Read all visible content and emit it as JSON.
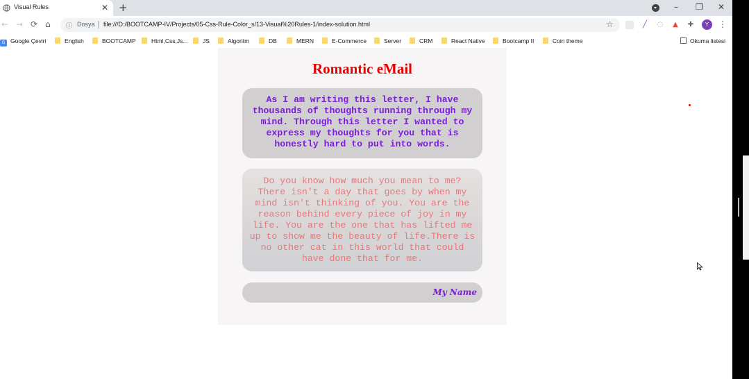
{
  "tab": {
    "title": "Visual Rules",
    "close": "✕"
  },
  "newtab_label": "+",
  "window": {
    "minimize": "–",
    "restore": "❐",
    "close": "✕"
  },
  "nav": {
    "back": "←",
    "forward": "→",
    "reload": "⟳",
    "home": "⌂"
  },
  "address": {
    "info_icon": "ⓘ",
    "scheme_label": "Dosya",
    "separator": "|",
    "url": "file:///D:/BOOTCAMP-IV/Projects/05-Css-Rule-Color_s/13-Visual%20Rules-1/index-solution.html",
    "star": "☆"
  },
  "profile_initial": "Y",
  "menu": "⋮",
  "bookmarks": [
    "Google Çeviri",
    "English",
    "BOOTCAMP",
    "Html,Css,Js...",
    "JS",
    "Algoritm",
    "DB",
    "MERN",
    "E-Commerce",
    "Server",
    "CRM",
    "React Native",
    "Bootcamp II",
    "Coin theme"
  ],
  "reading_list": "Okuma listesi",
  "page": {
    "title": "Romantic eMail",
    "paragraph1": "As I am writing this letter, I have thousands of thoughts running through my mind. Through this letter I wanted to express my thoughts for you that is honestly hard to put into words.",
    "paragraph2": "Do you know how much you mean to me? There isn't a day that goes by when my mind isn't thinking of you. You are the reason behind every piece of joy in my life. You are the one that has lifted me up to show me the beauty of life.There is no other cat in this world that could have done that for me.",
    "signature": "My Name"
  },
  "colors": {
    "title": "#e60000",
    "paragraph1": "#7a1fd6",
    "paragraph2": "#f07474",
    "bubble": "#d1cfcf"
  },
  "icons": [
    "globe-icon",
    "close-icon",
    "plus-icon",
    "minimize-icon",
    "restore-icon",
    "back-icon",
    "forward-icon",
    "reload-icon",
    "home-icon",
    "info-icon",
    "star-icon",
    "extensions-icon",
    "menu-icon",
    "folder-icon",
    "reading-list-icon",
    "mouse-cursor-icon"
  ]
}
